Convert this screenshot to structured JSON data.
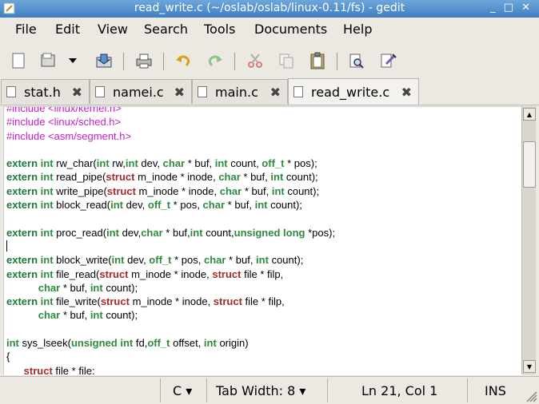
{
  "window": {
    "title": "read_write.c (~/oslab/oslab/linux-0.11/fs) - gedit",
    "controls": [
      "_",
      "□",
      "✕"
    ]
  },
  "menu": [
    "File",
    "Edit",
    "View",
    "Search",
    "Tools",
    "Documents",
    "Help"
  ],
  "toolbar": {
    "icons": [
      "new-document-icon",
      "open-icon",
      "open-dropdown-icon",
      "save-icon",
      "print-icon",
      "undo-icon",
      "redo-icon",
      "cut-icon",
      "copy-icon",
      "paste-icon",
      "find-icon",
      "find-replace-icon"
    ]
  },
  "tabs": [
    {
      "label": "stat.h",
      "close": "✖",
      "active": false
    },
    {
      "label": "namei.c",
      "close": "✖",
      "active": false
    },
    {
      "label": "main.c",
      "close": "✖",
      "active": false
    },
    {
      "label": "read_write.c",
      "close": "✖",
      "active": true
    }
  ],
  "editor": {
    "lines": [
      "#include <linux/kernel.h>",
      "#include <linux/sched.h>",
      "#include <asm/segment.h>",
      "",
      "extern int rw_char(int rw,int dev, char * buf, int count, off_t * pos);",
      "extern int read_pipe(struct m_inode * inode, char * buf, int count);",
      "extern int write_pipe(struct m_inode * inode, char * buf, int count);",
      "extern int block_read(int dev, off_t * pos, char * buf, int count);",
      "",
      "extern int proc_read(int dev,char * buf,int count,unsigned long *pos);",
      "",
      "extern int block_write(int dev, off_t * pos, char * buf, int count);",
      "extern int file_read(struct m_inode * inode, struct file * filp,",
      "           char * buf, int count);",
      "extern int file_write(struct m_inode * inode, struct file * filp,",
      "           char * buf, int count);",
      "",
      "int sys_lseek(unsigned int fd,off_t offset, int origin)",
      "{",
      "      struct file * file:"
    ]
  },
  "statusbar": {
    "language": "C ▾",
    "tab_width": "Tab Width:  8 ▾",
    "position": "Ln 21, Col 1",
    "mode": "INS"
  },
  "colors": {
    "titlebar": "#3f7fc1",
    "preprocessor": "#c81ec8",
    "keyword": "#1e7a3a",
    "struct": "#a52a2a"
  }
}
